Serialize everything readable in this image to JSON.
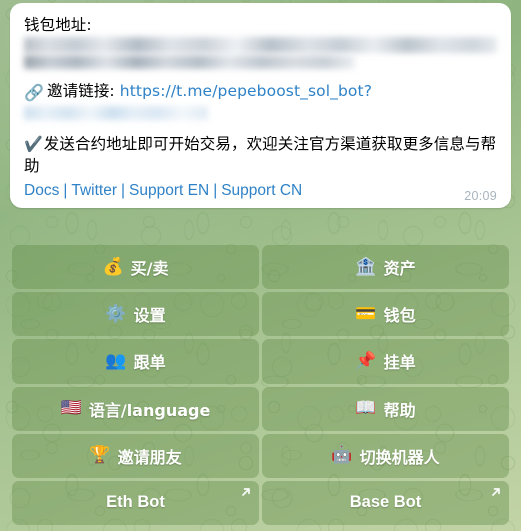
{
  "app": "telegram-bot-chat",
  "theme": {
    "bubble_bg": "#ffffff",
    "link_color": "#2f82c7",
    "keyboard_button_bg": "rgba(97,140,73,0.40)",
    "keyboard_text": "#ffffff",
    "chat_background": "#9ab98a",
    "timestamp_color": "#a8b4bd"
  },
  "message": {
    "wallet_label": "钱包地址:",
    "wallet_address_redacted": true,
    "wallet_address_note_redacted": true,
    "link_icon": "link-emoji",
    "link_icon_glyph": "🔗",
    "invite_label": "邀请链接:",
    "invite_url": "https://t.me/pepeboost_sol_bot?",
    "invite_url_tail_redacted": true,
    "check_icon": "check-mark",
    "check_icon_glyph": "✔️",
    "notice": "发送合约地址即可开始交易，欢迎关注官方渠道获取更多信息与帮助",
    "footer_links": [
      "Docs",
      "Twitter",
      "Support EN",
      "Support CN"
    ],
    "footer_separator": "|",
    "time": "20:09"
  },
  "keyboard": {
    "rows": [
      [
        {
          "emoji": "💰",
          "icon_name": "money-bag-icon",
          "label": "买/卖",
          "style": "emoji"
        },
        {
          "emoji": "🏦",
          "icon_name": "bank-icon",
          "label": "资产",
          "style": "emoji"
        }
      ],
      [
        {
          "emoji": "⚙️",
          "icon_name": "gear-icon",
          "label": "设置",
          "style": "emoji"
        },
        {
          "emoji": "💳",
          "icon_name": "credit-card-icon",
          "label": "钱包",
          "style": "emoji"
        }
      ],
      [
        {
          "emoji": "👥",
          "icon_name": "people-icon",
          "label": "跟单",
          "style": "emoji"
        },
        {
          "emoji": "📌",
          "icon_name": "pushpin-icon",
          "label": "挂单",
          "style": "emoji"
        }
      ],
      [
        {
          "emoji": "🇺🇸",
          "icon_name": "flag-us-icon",
          "label": "语言/language",
          "style": "emoji"
        },
        {
          "emoji": "📖",
          "icon_name": "open-book-icon",
          "label": "帮助",
          "style": "emoji"
        }
      ],
      [
        {
          "emoji": "🏆",
          "icon_name": "trophy-icon",
          "label": "邀请朋友",
          "style": "emoji"
        },
        {
          "emoji": "🤖",
          "icon_name": "robot-icon",
          "label": "切换机器人",
          "style": "emoji"
        }
      ],
      [
        {
          "emoji": "",
          "icon_name": "external-link-arrow-icon",
          "label": "Eth Bot",
          "style": "plain",
          "external": true
        },
        {
          "emoji": "",
          "icon_name": "external-link-arrow-icon",
          "label": "Base Bot",
          "style": "plain",
          "external": true
        }
      ]
    ]
  }
}
